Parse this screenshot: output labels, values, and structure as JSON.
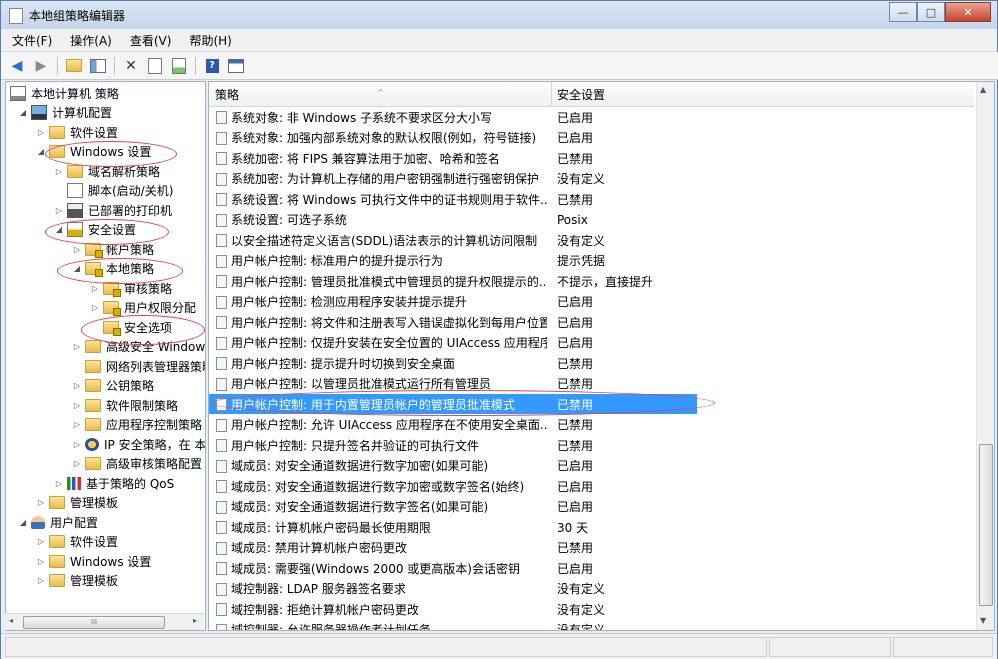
{
  "window": {
    "title": "本地组策略编辑器",
    "minimize_label": "—",
    "maximize_label": "□",
    "close_label": "✕"
  },
  "menu": [
    "文件(F)",
    "操作(A)",
    "查看(V)",
    "帮助(H)"
  ],
  "toolbar": {
    "icons": [
      "back-arrow-icon",
      "forward-arrow-icon",
      "up-folder-icon",
      "show-hide-tree-icon",
      "delete-icon",
      "properties-icon",
      "export-list-icon",
      "help-icon",
      "console-icon"
    ]
  },
  "tree": [
    {
      "label": "本地计算机 策略",
      "level": 0,
      "twisty": "",
      "icon": "computer-icon"
    },
    {
      "label": "计算机配置",
      "level": 1,
      "twisty": "◢",
      "icon": "computer-config-icon"
    },
    {
      "label": "软件设置",
      "level": 2,
      "twisty": "▷",
      "icon": "folder-icon"
    },
    {
      "label": "Windows 设置",
      "level": 2,
      "twisty": "◢",
      "icon": "folder-icon"
    },
    {
      "label": "域名解析策略",
      "level": 3,
      "twisty": "▷",
      "icon": "folder-icon"
    },
    {
      "label": "脚本(启动/关机)",
      "level": 3,
      "twisty": "",
      "icon": "script-icon"
    },
    {
      "label": "已部署的打印机",
      "level": 3,
      "twisty": "▷",
      "icon": "printer-icon"
    },
    {
      "label": "安全设置",
      "level": 3,
      "twisty": "◢",
      "icon": "security-settings-icon"
    },
    {
      "label": "帐户策略",
      "level": 4,
      "twisty": "▷",
      "icon": "folder-lock-icon"
    },
    {
      "label": "本地策略",
      "level": 4,
      "twisty": "◢",
      "icon": "folder-lock-icon"
    },
    {
      "label": "审核策略",
      "level": 5,
      "twisty": "▷",
      "icon": "folder-lock-icon"
    },
    {
      "label": "用户权限分配",
      "level": 5,
      "twisty": "▷",
      "icon": "folder-lock-icon"
    },
    {
      "label": "安全选项",
      "level": 5,
      "twisty": "",
      "icon": "folder-lock-icon"
    },
    {
      "label": "高级安全 Window",
      "level": 4,
      "twisty": "▷",
      "icon": "folder-icon"
    },
    {
      "label": "网络列表管理器策略",
      "level": 4,
      "twisty": "",
      "icon": "folder-icon"
    },
    {
      "label": "公钥策略",
      "level": 4,
      "twisty": "▷",
      "icon": "folder-icon"
    },
    {
      "label": "软件限制策略",
      "level": 4,
      "twisty": "▷",
      "icon": "folder-icon"
    },
    {
      "label": "应用程序控制策略",
      "level": 4,
      "twisty": "▷",
      "icon": "folder-icon"
    },
    {
      "label": "IP 安全策略，在 本",
      "level": 4,
      "twisty": "▷",
      "icon": "ip-security-icon"
    },
    {
      "label": "高级审核策略配置",
      "level": 4,
      "twisty": "▷",
      "icon": "folder-icon"
    },
    {
      "label": "基于策略的 QoS",
      "level": 3,
      "twisty": "▷",
      "icon": "qos-chart-icon"
    },
    {
      "label": "管理模板",
      "level": 2,
      "twisty": "▷",
      "icon": "folder-icon"
    },
    {
      "label": "用户配置",
      "level": 1,
      "twisty": "◢",
      "icon": "user-config-icon"
    },
    {
      "label": "软件设置",
      "level": 2,
      "twisty": "▷",
      "icon": "folder-icon"
    },
    {
      "label": "Windows 设置",
      "level": 2,
      "twisty": "▷",
      "icon": "folder-icon"
    },
    {
      "label": "管理模板",
      "level": 2,
      "twisty": "▷",
      "icon": "folder-icon"
    }
  ],
  "hscroll": {
    "thumb_label": "III",
    "left_arrow": "◂",
    "right_arrow": "▸"
  },
  "columns": {
    "policy": "策略",
    "setting": "安全设置",
    "sort_arrow": "^"
  },
  "rows": [
    {
      "policy": "系统对象: 非 Windows 子系统不要求区分大小写",
      "setting": "已启用"
    },
    {
      "policy": "系统对象: 加强内部系统对象的默认权限(例如，符号链接)",
      "setting": "已启用"
    },
    {
      "policy": "系统加密: 将 FIPS 兼容算法用于加密、哈希和签名",
      "setting": "已禁用"
    },
    {
      "policy": "系统加密: 为计算机上存储的用户密钥强制进行强密钥保护",
      "setting": "没有定义"
    },
    {
      "policy": "系统设置: 将 Windows 可执行文件中的证书规则用于软件...",
      "setting": "已禁用"
    },
    {
      "policy": "系统设置: 可选子系统",
      "setting": "Posix"
    },
    {
      "policy": "以安全描述符定义语言(SDDL)语法表示的计算机访问限制",
      "setting": "没有定义"
    },
    {
      "policy": "用户帐户控制: 标准用户的提升提示行为",
      "setting": "提示凭据"
    },
    {
      "policy": "用户帐户控制: 管理员批准模式中管理员的提升权限提示的...",
      "setting": "不提示，直接提升"
    },
    {
      "policy": "用户帐户控制: 检测应用程序安装并提示提升",
      "setting": "已启用"
    },
    {
      "policy": "用户帐户控制: 将文件和注册表写入错误虚拟化到每用户位置",
      "setting": "已启用"
    },
    {
      "policy": "用户帐户控制: 仅提升安装在安全位置的 UIAccess 应用程序",
      "setting": "已启用"
    },
    {
      "policy": "用户帐户控制: 提示提升时切换到安全桌面",
      "setting": "已禁用"
    },
    {
      "policy": "用户帐户控制: 以管理员批准模式运行所有管理员",
      "setting": "已禁用"
    },
    {
      "policy": "用户帐户控制: 用于内置管理员帐户的管理员批准模式",
      "setting": "已禁用"
    },
    {
      "policy": "用户帐户控制: 允许 UIAccess 应用程序在不使用安全桌面...",
      "setting": "已禁用"
    },
    {
      "policy": "用户帐户控制: 只提升签名并验证的可执行文件",
      "setting": "已禁用"
    },
    {
      "policy": "域成员: 对安全通道数据进行数字加密(如果可能)",
      "setting": "已启用"
    },
    {
      "policy": "域成员: 对安全通道数据进行数字加密或数字签名(始终)",
      "setting": "已启用"
    },
    {
      "policy": "域成员: 对安全通道数据进行数字签名(如果可能)",
      "setting": "已启用"
    },
    {
      "policy": "域成员: 计算机帐户密码最长使用期限",
      "setting": "30 天"
    },
    {
      "policy": "域成员: 禁用计算机帐户密码更改",
      "setting": "已禁用"
    },
    {
      "policy": "域成员: 需要强(Windows 2000 或更高版本)会话密钥",
      "setting": "已启用"
    },
    {
      "policy": "域控制器: LDAP 服务器签名要求",
      "setting": "没有定义"
    },
    {
      "policy": "域控制器: 拒绝计算机帐户密码更改",
      "setting": "没有定义"
    },
    {
      "policy": "域控制器: 允许服务器操作者计划任务",
      "setting": "没有定义"
    }
  ],
  "selected_row": 14,
  "colors": {
    "selection": "#3399ff",
    "annotation": "#e0424a"
  }
}
